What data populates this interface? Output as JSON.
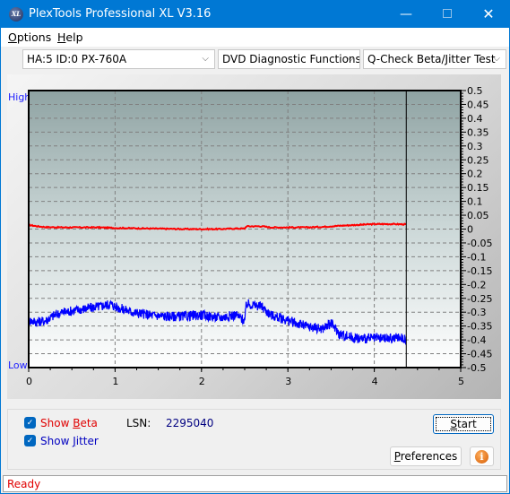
{
  "window": {
    "title": "PlexTools Professional XL V3.16",
    "app_icon_text": "XL",
    "minimize_glyph": "—",
    "close_glyph": "✕"
  },
  "menu": {
    "items": [
      {
        "label": "Options",
        "mnemonic": "O",
        "rest": "ptions"
      },
      {
        "label": "Help",
        "mnemonic": "H",
        "rest": "elp"
      }
    ]
  },
  "toolbar": {
    "drive_select": "HA:5 ID:0  PX-760A",
    "function_select": "DVD Diagnostic Functions",
    "test_select": "Q-Check Beta/Jitter Test",
    "arrow_glyph": "⌵"
  },
  "chart": {
    "high_label": "High",
    "low_label": "Low"
  },
  "chart_data": {
    "type": "line",
    "title": "",
    "xlabel": "",
    "ylabel": "",
    "xlim": [
      0,
      5
    ],
    "ylim": [
      -0.5,
      0.5
    ],
    "x_ticks": [
      "0",
      "1",
      "2",
      "3",
      "4",
      "5"
    ],
    "y_ticks": [
      "0.5",
      "0.45",
      "0.4",
      "0.35",
      "0.3",
      "0.25",
      "0.2",
      "0.15",
      "0.1",
      "0.05",
      "0",
      "-0.05",
      "-0.1",
      "-0.15",
      "-0.2",
      "-0.25",
      "-0.3",
      "-0.35",
      "-0.4",
      "-0.45",
      "-0.5"
    ],
    "grid": true,
    "position_marker_x": 4.37,
    "series": [
      {
        "name": "Beta",
        "color": "#ff0000",
        "x": [
          0.0,
          0.1,
          0.2,
          0.4,
          0.6,
          0.8,
          1.0,
          1.2,
          1.4,
          1.6,
          1.8,
          2.0,
          2.2,
          2.4,
          2.5,
          2.52,
          2.7,
          2.8,
          3.0,
          3.2,
          3.4,
          3.6,
          3.8,
          4.0,
          4.2,
          4.37
        ],
        "values": [
          0.015,
          0.01,
          0.007,
          0.006,
          0.006,
          0.006,
          0.004,
          0.003,
          0.002,
          0.001,
          0.0,
          0.0,
          0.0,
          0.002,
          0.002,
          0.01,
          0.01,
          0.006,
          0.006,
          0.006,
          0.008,
          0.012,
          0.015,
          0.018,
          0.018,
          0.017
        ]
      },
      {
        "name": "Jitter",
        "color": "#0000ff",
        "x": [
          0.0,
          0.1,
          0.2,
          0.3,
          0.4,
          0.6,
          0.8,
          0.95,
          1.0,
          1.2,
          1.4,
          1.6,
          1.8,
          2.0,
          2.2,
          2.4,
          2.5,
          2.52,
          2.7,
          2.8,
          3.0,
          3.2,
          3.4,
          3.5,
          3.6,
          3.8,
          4.0,
          4.2,
          4.3,
          4.37
        ],
        "values": [
          -0.33,
          -0.335,
          -0.33,
          -0.31,
          -0.3,
          -0.29,
          -0.28,
          -0.27,
          -0.28,
          -0.3,
          -0.31,
          -0.315,
          -0.315,
          -0.31,
          -0.32,
          -0.31,
          -0.33,
          -0.27,
          -0.28,
          -0.31,
          -0.33,
          -0.35,
          -0.36,
          -0.34,
          -0.38,
          -0.395,
          -0.395,
          -0.395,
          -0.39,
          -0.4
        ]
      }
    ]
  },
  "controls": {
    "show_beta": {
      "prefix": "Show ",
      "mnemonic": "B",
      "rest": "eta",
      "checked": true,
      "color": "#e00000"
    },
    "show_jitter": {
      "prefix": "Show ",
      "mnemonic": "J",
      "rest": "itter",
      "checked": true,
      "color": "#0000c0"
    },
    "lsn_label": "LSN:",
    "lsn_value": "2295040",
    "start_button": {
      "mnemonic": "S",
      "rest": "tart"
    },
    "preferences_button": {
      "mnemonic": "P",
      "rest": "references"
    },
    "info_glyph": "i",
    "check_glyph": "✓"
  },
  "status": {
    "text": "Ready"
  }
}
